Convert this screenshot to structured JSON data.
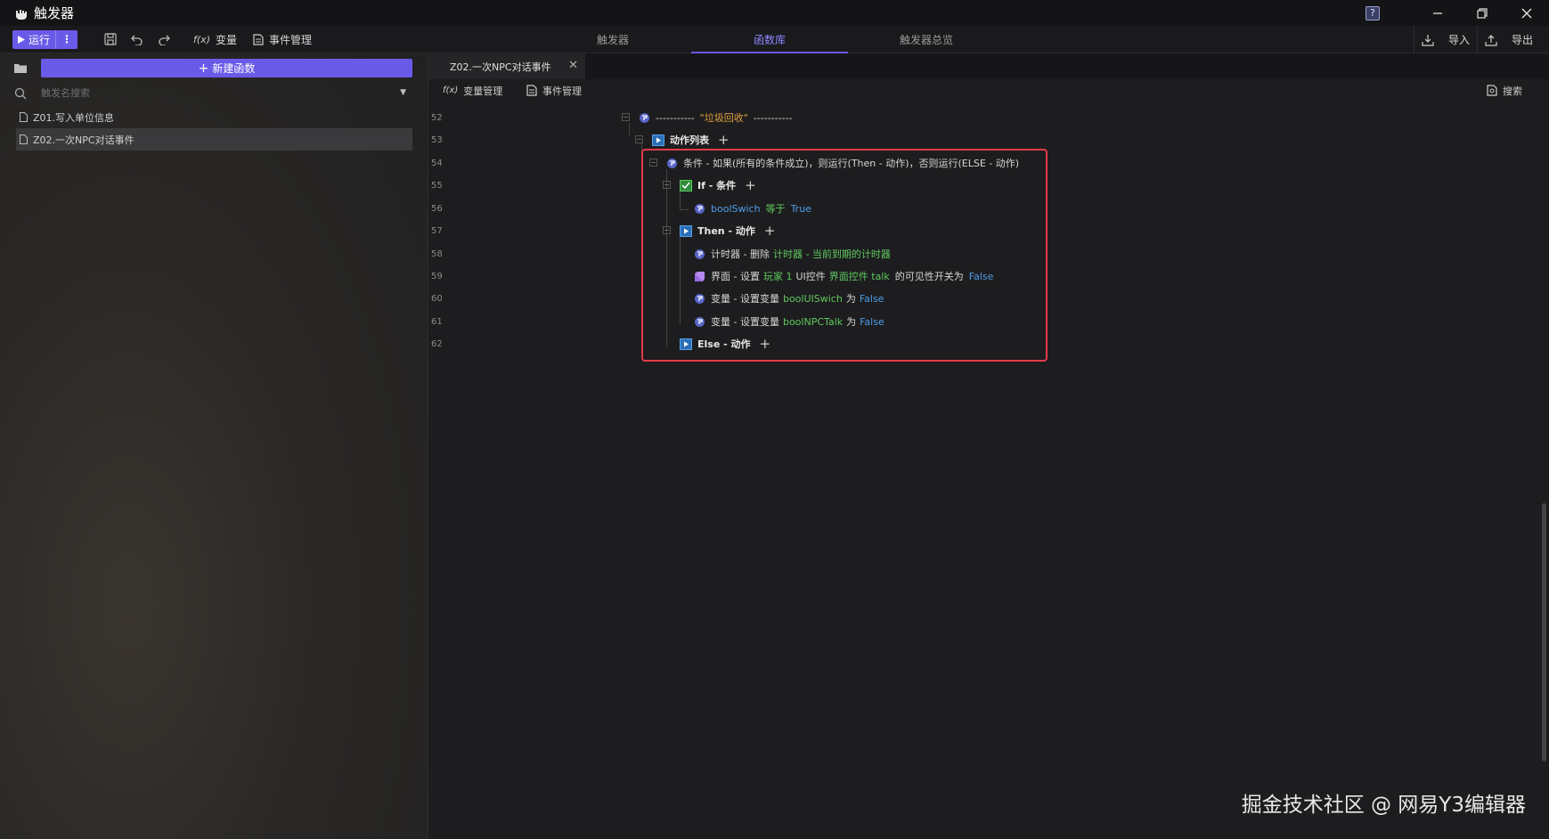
{
  "window": {
    "title": "触发器"
  },
  "toolbar": {
    "run_label": "运行",
    "variable_label": "变量",
    "event_manage_label": "事件管理",
    "tabs": [
      {
        "label": "触发器"
      },
      {
        "label": "函数库"
      },
      {
        "label": "触发器总览"
      }
    ],
    "import_label": "导入",
    "export_label": "导出"
  },
  "sidebar": {
    "new_function_label": "新建函数",
    "search_placeholder": "触发名搜索",
    "files": [
      {
        "label": "Z01.写入单位信息"
      },
      {
        "label": "Z02.一次NPC对话事件"
      }
    ]
  },
  "editor": {
    "tab_label": "Z02.一次NPC对话事件",
    "var_manage_label": "变量管理",
    "event_manage_label": "事件管理",
    "search_label": "搜索",
    "line_numbers": [
      "52",
      "53",
      "54",
      "55",
      "56",
      "57",
      "58",
      "59",
      "60",
      "61",
      "62"
    ],
    "rows": {
      "r52_dash1": "-----------",
      "r52_name": "\"垃圾回收\"",
      "r52_dash2": "-----------",
      "r53": "动作列表",
      "r54": "条件 - 如果(所有的条件成立)，则运行(Then - 动作)，否则运行(ELSE - 动作)",
      "r55": "If - 条件",
      "r56_var": "boolSwich",
      "r56_op": "等于",
      "r56_val": "True",
      "r57": "Then - 动作",
      "r58_a": "计时器 - 删除",
      "r58_b": "计时器 - 当前到期的计时器",
      "r59_a": "界面 - 设置",
      "r59_b": "玩家 1",
      "r59_c": "UI控件",
      "r59_d": "界面控件 talk",
      "r59_e": "的可见性开关为",
      "r59_f": "False",
      "r60_a": "变量 - 设置变量",
      "r60_b": "boolUISwich",
      "r60_c": "为",
      "r60_d": "False",
      "r61_a": "变量 - 设置变量",
      "r61_b": "boolNPCTalk",
      "r61_c": "为",
      "r61_d": "False",
      "r62": "Else - 动作"
    }
  },
  "watermark": "掘金技术社区 @ 网易Y3编辑器",
  "colors": {
    "accent": "#6a5ae8",
    "highlight": "#e23a4a",
    "green": "#5fc95f",
    "blue": "#4e9de8",
    "orange": "#e0a040"
  }
}
